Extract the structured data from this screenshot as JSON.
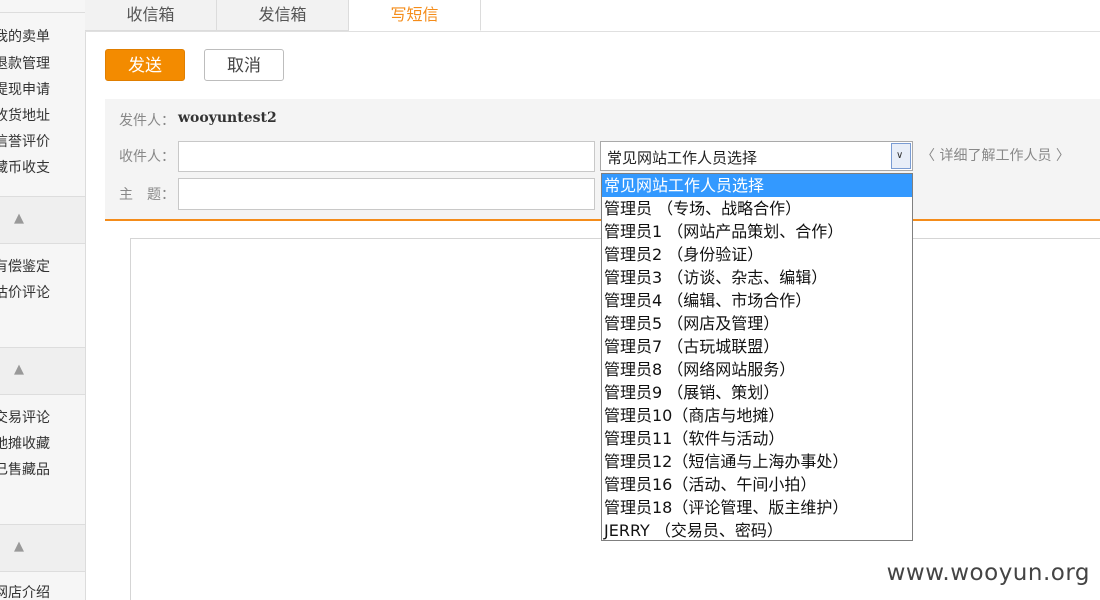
{
  "sidebar": {
    "group1": [
      "我的卖单",
      "退款管理",
      "提现申请",
      "收货地址",
      "信誉评价",
      "藏币收支"
    ],
    "group2": [
      "有偿鉴定",
      "估价评论"
    ],
    "group3": [
      "交易评论",
      "地摊收藏",
      "已售藏品"
    ],
    "group4": [
      "网店介绍"
    ],
    "head_caret": "^"
  },
  "tabs": [
    "收信箱",
    "发信箱",
    "写短信"
  ],
  "toolbar": {
    "send": "发送",
    "cancel": "取消"
  },
  "form": {
    "sender_label": "发件人：",
    "sender_value": "wooyuntest2",
    "recipient_label": "收件人：",
    "recipient_value": "",
    "subject_label": "主　题：",
    "subject_value": "",
    "staff_select_value": "常见网站工作人员选择",
    "detail_link": "〈 详细了解工作人员 〉"
  },
  "dropdown_options": [
    "常见网站工作人员选择",
    "管理员 （专场、战略合作）",
    "管理员1 （网站产品策划、合作）",
    "管理员2 （身份验证）",
    "管理员3 （访谈、杂志、编辑）",
    "管理员4 （编辑、市场合作）",
    "管理员5 （网店及管理）",
    "管理员7 （古玩城联盟）",
    "管理员8 （网络网站服务）",
    "管理员9 （展销、策划）",
    "管理员10（商店与地摊）",
    "管理员11（软件与活动）",
    "管理员12（短信通与上海办事处）",
    "管理员16（活动、午间小拍）",
    "管理员18（评论管理、版主维护）",
    "JERRY （交易员、密码）"
  ],
  "selected_option_index": 0,
  "watermark": "www.wooyun.org",
  "colors": {
    "accent": "#f48c1a",
    "send_button": "#f38b00",
    "selection": "#3399ff"
  }
}
